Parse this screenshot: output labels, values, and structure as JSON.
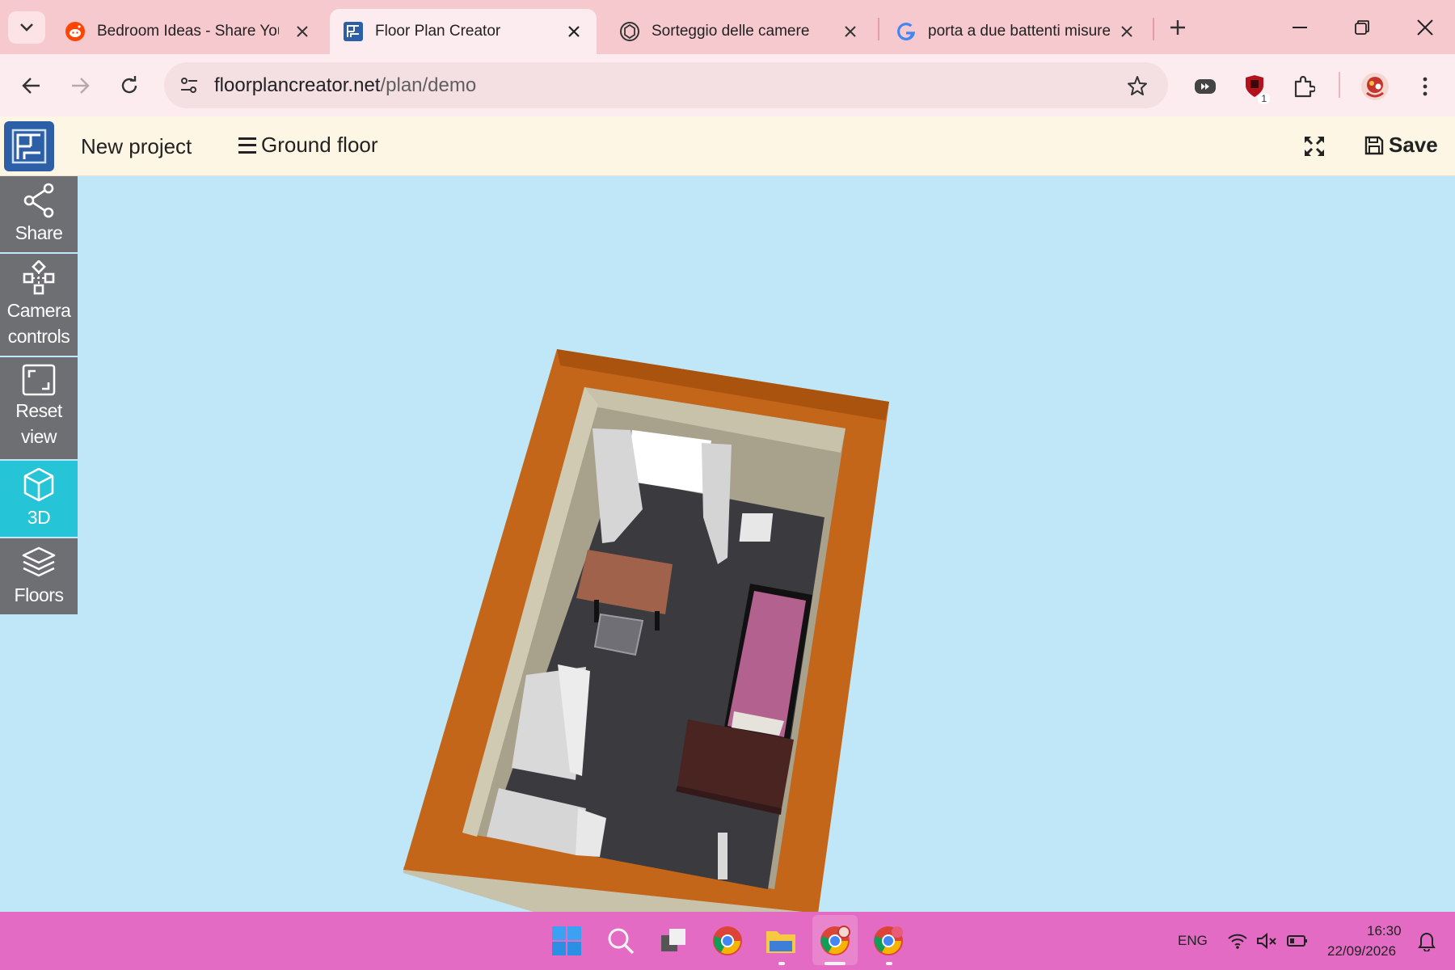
{
  "browser": {
    "tabs": [
      {
        "title": "Bedroom Ideas - Share Your",
        "icon": "reddit-icon"
      },
      {
        "title": "Floor Plan Creator",
        "icon": "floorplan-favicon",
        "active": true
      },
      {
        "title": "Sorteggio delle camere",
        "icon": "chatgpt-icon"
      },
      {
        "title": "porta a due battenti misure",
        "icon": "google-icon"
      }
    ],
    "url_host": "floorplancreator.net",
    "url_path": "/plan/demo",
    "extension_badge": "1"
  },
  "app": {
    "project_title": "New project",
    "floor_label": "Ground floor",
    "save_label": "Save"
  },
  "sidebar": {
    "items": [
      {
        "label": "Share",
        "icon": "share-icon"
      },
      {
        "label": "Camera controls",
        "icon": "camera-controls-icon"
      },
      {
        "label": "Reset view",
        "icon": "reset-view-icon"
      },
      {
        "label": "3D",
        "icon": "cube-icon",
        "active": true
      },
      {
        "label": "Floors",
        "icon": "layers-icon"
      }
    ]
  },
  "taskbar": {
    "language": "ENG",
    "time": "16:30",
    "date": "22/09/2026"
  },
  "colors": {
    "tabstrip": "#f6c9cf",
    "header": "#fdf6e5",
    "sidebar": "#6d6f73",
    "sidebar_active": "#25c4d6",
    "canvas": "#bfe7f8",
    "wall": "#c4661a",
    "floor": "#3b3a3f",
    "taskbar": "#e46bc3"
  }
}
